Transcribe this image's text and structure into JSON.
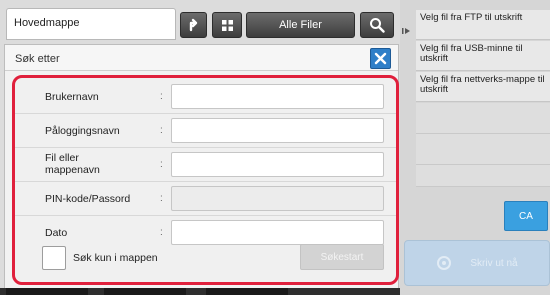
{
  "topbar": {
    "main_folder": "Hovedmappe",
    "all_files_label": "Alle Filer"
  },
  "dialog": {
    "title": "Søk etter",
    "fields": [
      {
        "label": "Brukernavn",
        "colon": ":",
        "value": ""
      },
      {
        "label": "Påloggingsnavn",
        "colon": ":",
        "value": ""
      },
      {
        "label": "Fil eller mappenavn",
        "colon": ":",
        "value": ""
      },
      {
        "label": "PIN-kode/Passord",
        "colon": ":",
        "value": ""
      },
      {
        "label": "Dato",
        "colon": ":",
        "value": ""
      }
    ],
    "search_in_folder_label": "Søk kun i mappen",
    "start_label": "Søkestart"
  },
  "right_panel": {
    "tasks": [
      {
        "label": "Velg fil fra FTP til utskrift"
      },
      {
        "label": "Velg fil fra USB-minne til utskrift"
      },
      {
        "label": "Velg fil fra nettverks-mappe til utskrift"
      }
    ],
    "ca_label": "CA",
    "print_label": "Skriv ut nå"
  },
  "colors": {
    "highlight_frame": "#e0203c",
    "close_button": "#2f7fc8",
    "ca_button": "#3aa0e0"
  }
}
